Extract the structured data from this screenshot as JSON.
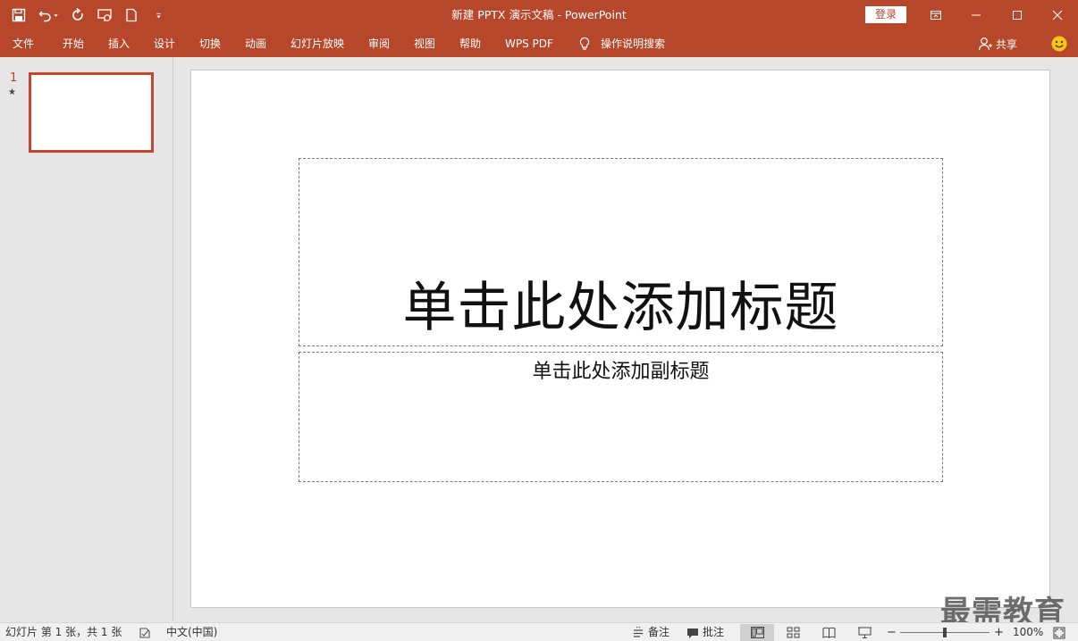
{
  "titlebar": {
    "title": "新建 PPTX 演示文稿  -  PowerPoint",
    "login_label": "登录",
    "qat_icons": [
      "save-icon",
      "undo-icon",
      "redo-icon",
      "slideshow-from-start-icon",
      "new-file-icon",
      "customize-qat-icon"
    ],
    "window_controls": [
      "ribbon-display-options-icon",
      "minimize-icon",
      "maximize-icon",
      "close-icon"
    ]
  },
  "ribbon": {
    "tabs": [
      "文件",
      "开始",
      "插入",
      "设计",
      "切换",
      "动画",
      "幻灯片放映",
      "审阅",
      "视图",
      "帮助",
      "WPS PDF"
    ],
    "tell_me": "操作说明搜索",
    "share": "共享"
  },
  "slide_pane": {
    "slide_number": "1",
    "slide_marker": "★"
  },
  "slide": {
    "title_placeholder": "单击此处添加标题",
    "subtitle_placeholder": "单击此处添加副标题"
  },
  "statusbar": {
    "slide_info": "幻灯片 第 1 张，共 1 张",
    "language": "中文(中国)",
    "notes": "备注",
    "comments": "批注",
    "zoom_out": "−",
    "zoom_in": "+",
    "zoom_level": "100%",
    "zoom_fraction": 0.5
  },
  "watermark": "最需教育",
  "colors": {
    "accent": "#b7472a",
    "thumbnail_border": "#c5472b",
    "background": "#e6e6e6"
  }
}
